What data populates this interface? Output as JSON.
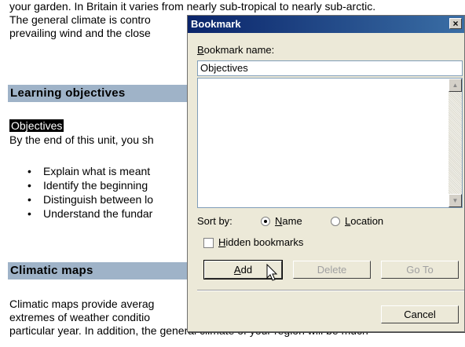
{
  "document": {
    "lines_top": [
      "your garden. In Britain it varies from nearly sub-tropical to nearly sub-arctic.",
      "The general climate is contro",
      "prevailing wind and the close"
    ],
    "heading_learning": "Learning objectives",
    "selected_word": "Objectives",
    "intro_line": "By the end of this unit, you sh",
    "bullets": [
      "Explain what is meant",
      "Identify the beginning",
      "Distinguish between lo",
      "Understand the fundar"
    ],
    "heading_climatic": "Climatic maps",
    "lines_bottom": [
      "Climatic maps provide averag",
      "extremes of weather conditio",
      "particular year. In addition, the general climate of your region will be much"
    ]
  },
  "dialog": {
    "title": "Bookmark",
    "close_glyph": "×",
    "name_label_accel": "B",
    "name_label_rest": "ookmark name:",
    "name_value": "Objectives",
    "sort_by_label": "Sort by:",
    "sort_options": [
      {
        "accel": "N",
        "rest": "ame",
        "checked": true
      },
      {
        "accel": "L",
        "rest": "ocation",
        "checked": false
      }
    ],
    "hidden_accel": "H",
    "hidden_rest": "idden bookmarks",
    "hidden_checked": false,
    "buttons": {
      "add_accel": "A",
      "add_rest": "dd",
      "delete": "Delete",
      "goto": "Go To",
      "cancel": "Cancel"
    }
  }
}
